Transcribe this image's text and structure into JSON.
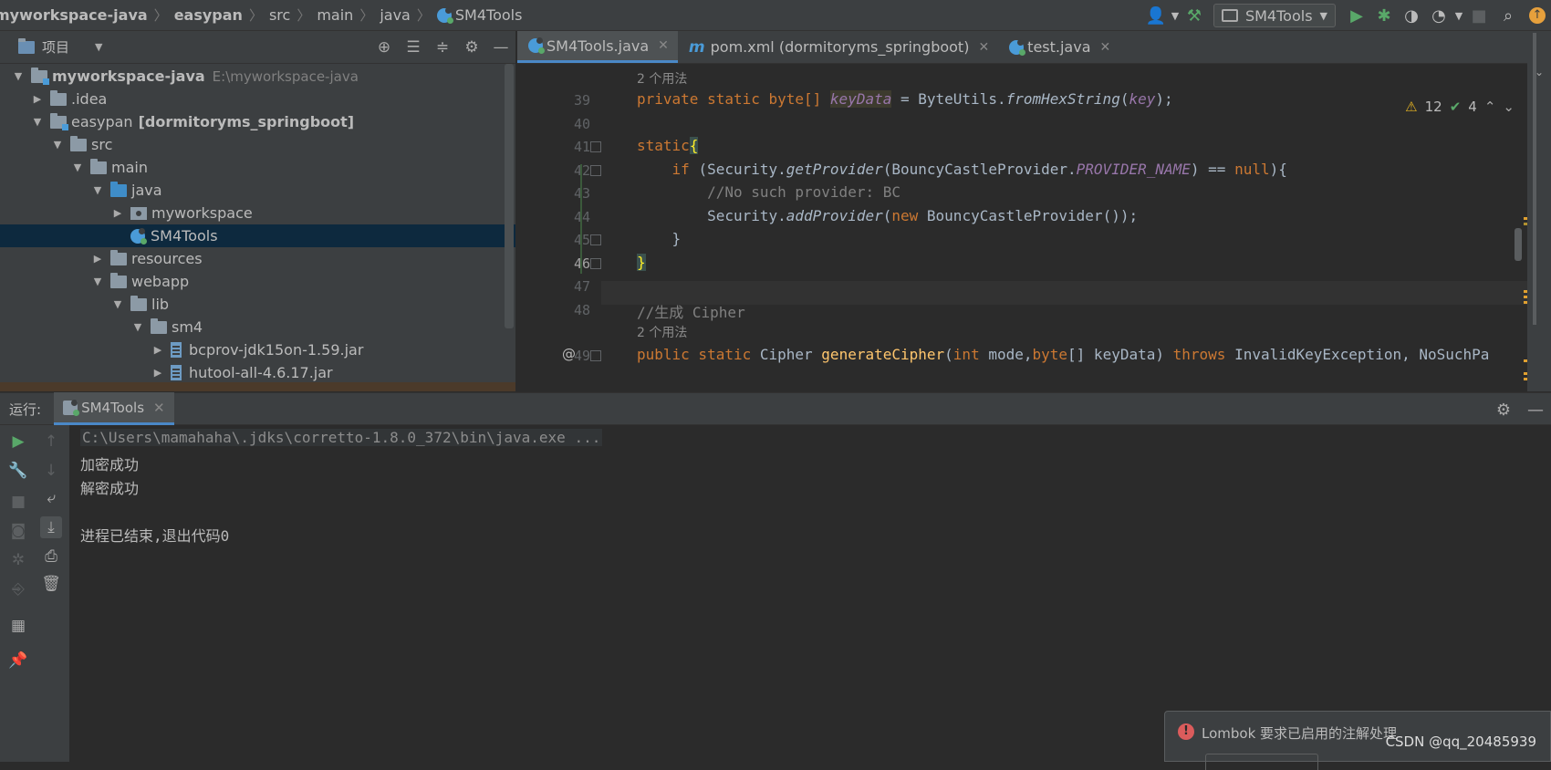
{
  "navbar": {
    "breadcrumb": [
      "myworkspace-java",
      "easypan",
      "src",
      "main",
      "java",
      "SM4Tools"
    ],
    "run_config": "SM4Tools"
  },
  "project": {
    "title": "项目",
    "rows": [
      {
        "label": "myworkspace-java",
        "suffix": "E:\\myworkspace-java"
      },
      {
        "label": ".idea"
      },
      {
        "label": "easypan",
        "suffix": "[dormitoryms_springboot]"
      },
      {
        "label": "src"
      },
      {
        "label": "main"
      },
      {
        "label": "java"
      },
      {
        "label": "myworkspace"
      },
      {
        "label": "SM4Tools"
      },
      {
        "label": "resources"
      },
      {
        "label": "webapp"
      },
      {
        "label": "lib"
      },
      {
        "label": "sm4"
      },
      {
        "label": "bcprov-jdk15on-1.59.jar"
      },
      {
        "label": "hutool-all-4.6.17.jar"
      }
    ]
  },
  "editor": {
    "tabs": [
      {
        "label": "SM4Tools.java",
        "icon": "java-class-icon"
      },
      {
        "label": "pom.xml (dormitoryms_springboot)",
        "icon": "maven-icon"
      },
      {
        "label": "test.java",
        "icon": "java-class-icon"
      }
    ],
    "inspections": {
      "warnings": "12",
      "ok": "4"
    },
    "usage_hint": "2 个用法",
    "lines": [
      {
        "num": "39"
      },
      {
        "num": "40"
      },
      {
        "num": "41"
      },
      {
        "num": "42"
      },
      {
        "num": "43"
      },
      {
        "num": "44"
      },
      {
        "num": "45"
      },
      {
        "num": "46"
      },
      {
        "num": "47"
      },
      {
        "num": "48"
      },
      {
        "num": "49"
      }
    ],
    "code": {
      "l39_a": "private static byte[] ",
      "l39_b": "keyData",
      "l39_c": " = ByteUtils.",
      "l39_d": "fromHexString",
      "l39_e": "(",
      "l39_f": "key",
      "l39_g": ");",
      "l41_a": "static",
      "l41_b": "{",
      "l42_a": "    if ",
      "l42_b": "(Security.",
      "l42_c": "getProvider",
      "l42_d": "(BouncyCastleProvider.",
      "l42_e": "PROVIDER_NAME",
      "l42_f": ") == ",
      "l42_g": "null",
      "l42_h": "){",
      "l43": "        //No such provider: BC",
      "l44_a": "        Security.",
      "l44_b": "addProvider",
      "l44_c": "(",
      "l44_d": "new ",
      "l44_e": "BouncyCastleProvider());",
      "l45": "    }",
      "l46": "}",
      "l48": "//生成 Cipher",
      "l49_a": "public static ",
      "l49_b": "Cipher ",
      "l49_c": "generateCipher",
      "l49_d": "(",
      "l49_e": "int ",
      "l49_f": "mode,",
      "l49_g": "byte",
      "l49_h": "[] keyData) ",
      "l49_i": "throws ",
      "l49_j": "InvalidKeyException, NoSuchPa"
    }
  },
  "run": {
    "title": "运行:",
    "tab": "SM4Tools",
    "console": [
      "C:\\Users\\mamahaha\\.jdks\\corretto-1.8.0_372\\bin\\java.exe ...",
      "加密成功",
      "解密成功",
      "",
      "进程已结束,退出代码0"
    ]
  },
  "notification": {
    "message": "Lombok 要求已启用的注解处理"
  },
  "watermark": "CSDN @qq_20485939"
}
